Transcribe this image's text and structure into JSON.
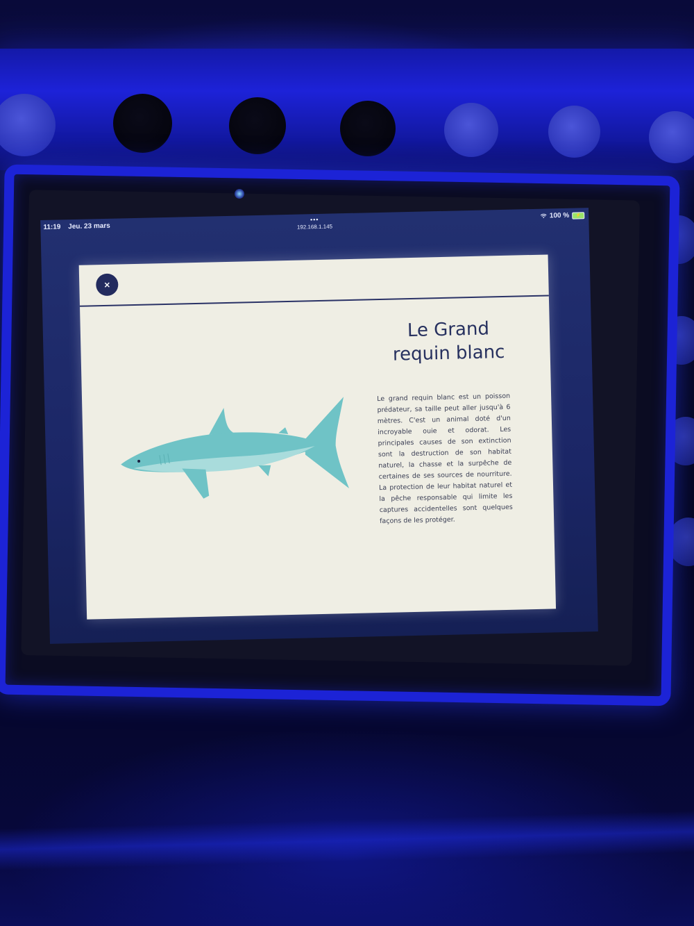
{
  "status_bar": {
    "time": "11:19",
    "date": "Jeu. 23 mars",
    "dots": "•••",
    "url": "192.168.1.145",
    "battery_percent": "100 %",
    "wifi_icon": "wifi-icon",
    "battery_icon": "battery-charging-icon"
  },
  "modal": {
    "close_label": "×",
    "title": "Le Grand\nrequin blanc",
    "description": "Le grand requin blanc est un poisson prédateur, sa taille peut aller jusqu'à 6 mètres. C'est un animal doté d'un incroyable ouie et odorat. Les principales causes de son extinction sont la destruction de son habitat naturel, la chasse et la surpêche de certaines de ses sources de nourriture. La protection de leur habitat naturel et la pêche responsable qui limite les captures accidentelles sont quelques façons de les protéger.",
    "illustration": "shark-illustration"
  },
  "colors": {
    "card_background": "#efeee4",
    "accent_navy": "#232b5e",
    "shark_body": "#6fc3c6",
    "shark_belly": "#a9dcdc",
    "case_blue": "#1c23d6"
  }
}
